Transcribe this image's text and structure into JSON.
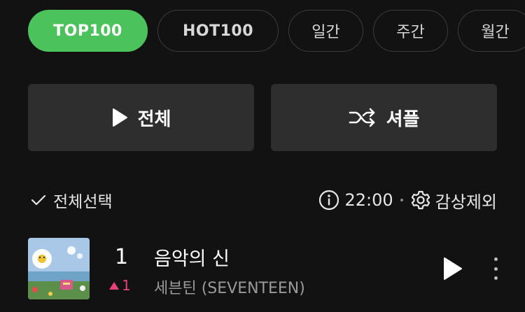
{
  "filters": [
    {
      "label": "TOP100",
      "active": true
    },
    {
      "label": "HOT100",
      "active": false
    },
    {
      "label": "일간",
      "active": false
    },
    {
      "label": "주간",
      "active": false
    },
    {
      "label": "월간",
      "active": false
    }
  ],
  "actions": {
    "play_all_label": "전체",
    "shuffle_label": "셔플"
  },
  "toolbar": {
    "select_all_label": "전체선택",
    "update_time": "22:00",
    "exclude_label": "감상제외"
  },
  "songs": [
    {
      "rank": "1",
      "rank_change": "1",
      "rank_direction": "up",
      "title": "음악의 신",
      "artist": "세븐틴 (SEVENTEEN)"
    }
  ],
  "colors": {
    "accent_green": "#4cc35a",
    "rank_up": "#e8417a",
    "background": "#121212",
    "button_bg": "#2e2e2e"
  },
  "icons": {
    "play_all": "play-icon",
    "shuffle": "shuffle-icon",
    "select_all": "check-icon",
    "info": "info-icon",
    "settings": "gear-icon",
    "more": "more-vertical-icon"
  }
}
